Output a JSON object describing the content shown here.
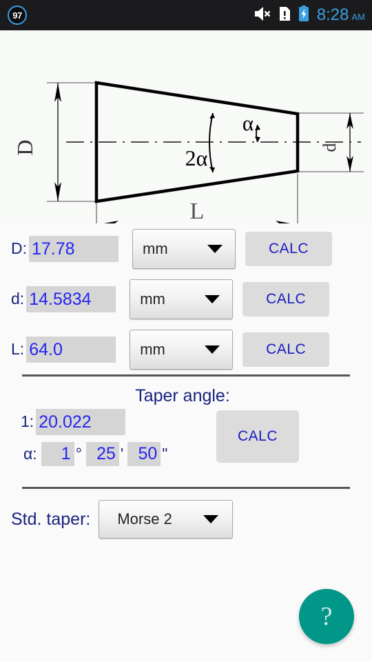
{
  "statusbar": {
    "notification_badge": "97",
    "icons": [
      "volume-mute-icon",
      "warning-document-icon",
      "battery-charging-icon"
    ],
    "time": "8:28",
    "ampm": "AM",
    "accent_color": "#3a9fe0",
    "background": "#1b1b1d"
  },
  "diagram": {
    "name": "taper-cone-diagram",
    "labels": {
      "major_diameter": "D",
      "minor_diameter": "d",
      "length": "L",
      "half_angle": "α",
      "full_angle": "2α"
    }
  },
  "rows": [
    {
      "label": "D:",
      "value": "17.78",
      "unit": "mm",
      "calc_label": "CALC",
      "field_name": "major-diameter"
    },
    {
      "label": "d:",
      "value": "14.5834",
      "unit": "mm",
      "calc_label": "CALC",
      "field_name": "minor-diameter"
    },
    {
      "label": "L:",
      "value": "64.0",
      "unit": "mm",
      "calc_label": "CALC",
      "field_name": "length"
    }
  ],
  "taper": {
    "title": "Taper angle:",
    "ratio_label": "1:",
    "ratio_value": "20.022",
    "alpha_label": "α:",
    "degrees": "1",
    "degrees_symbol": "°",
    "minutes": "25",
    "minutes_symbol": "'",
    "seconds": "50",
    "seconds_symbol": "\"",
    "calc_label": "CALC"
  },
  "std_taper": {
    "label": "Std. taper:",
    "selected": "Morse 2"
  },
  "fab": {
    "icon": "help-question-icon",
    "glyph": "?",
    "color": "#009688"
  },
  "theme": {
    "background": "#fafafa",
    "label_color": "#1a237e",
    "value_color": "#2525f0",
    "field_bg": "#d5d5d5",
    "button_bg": "#dcdcdc",
    "divider_color": "#545659"
  }
}
